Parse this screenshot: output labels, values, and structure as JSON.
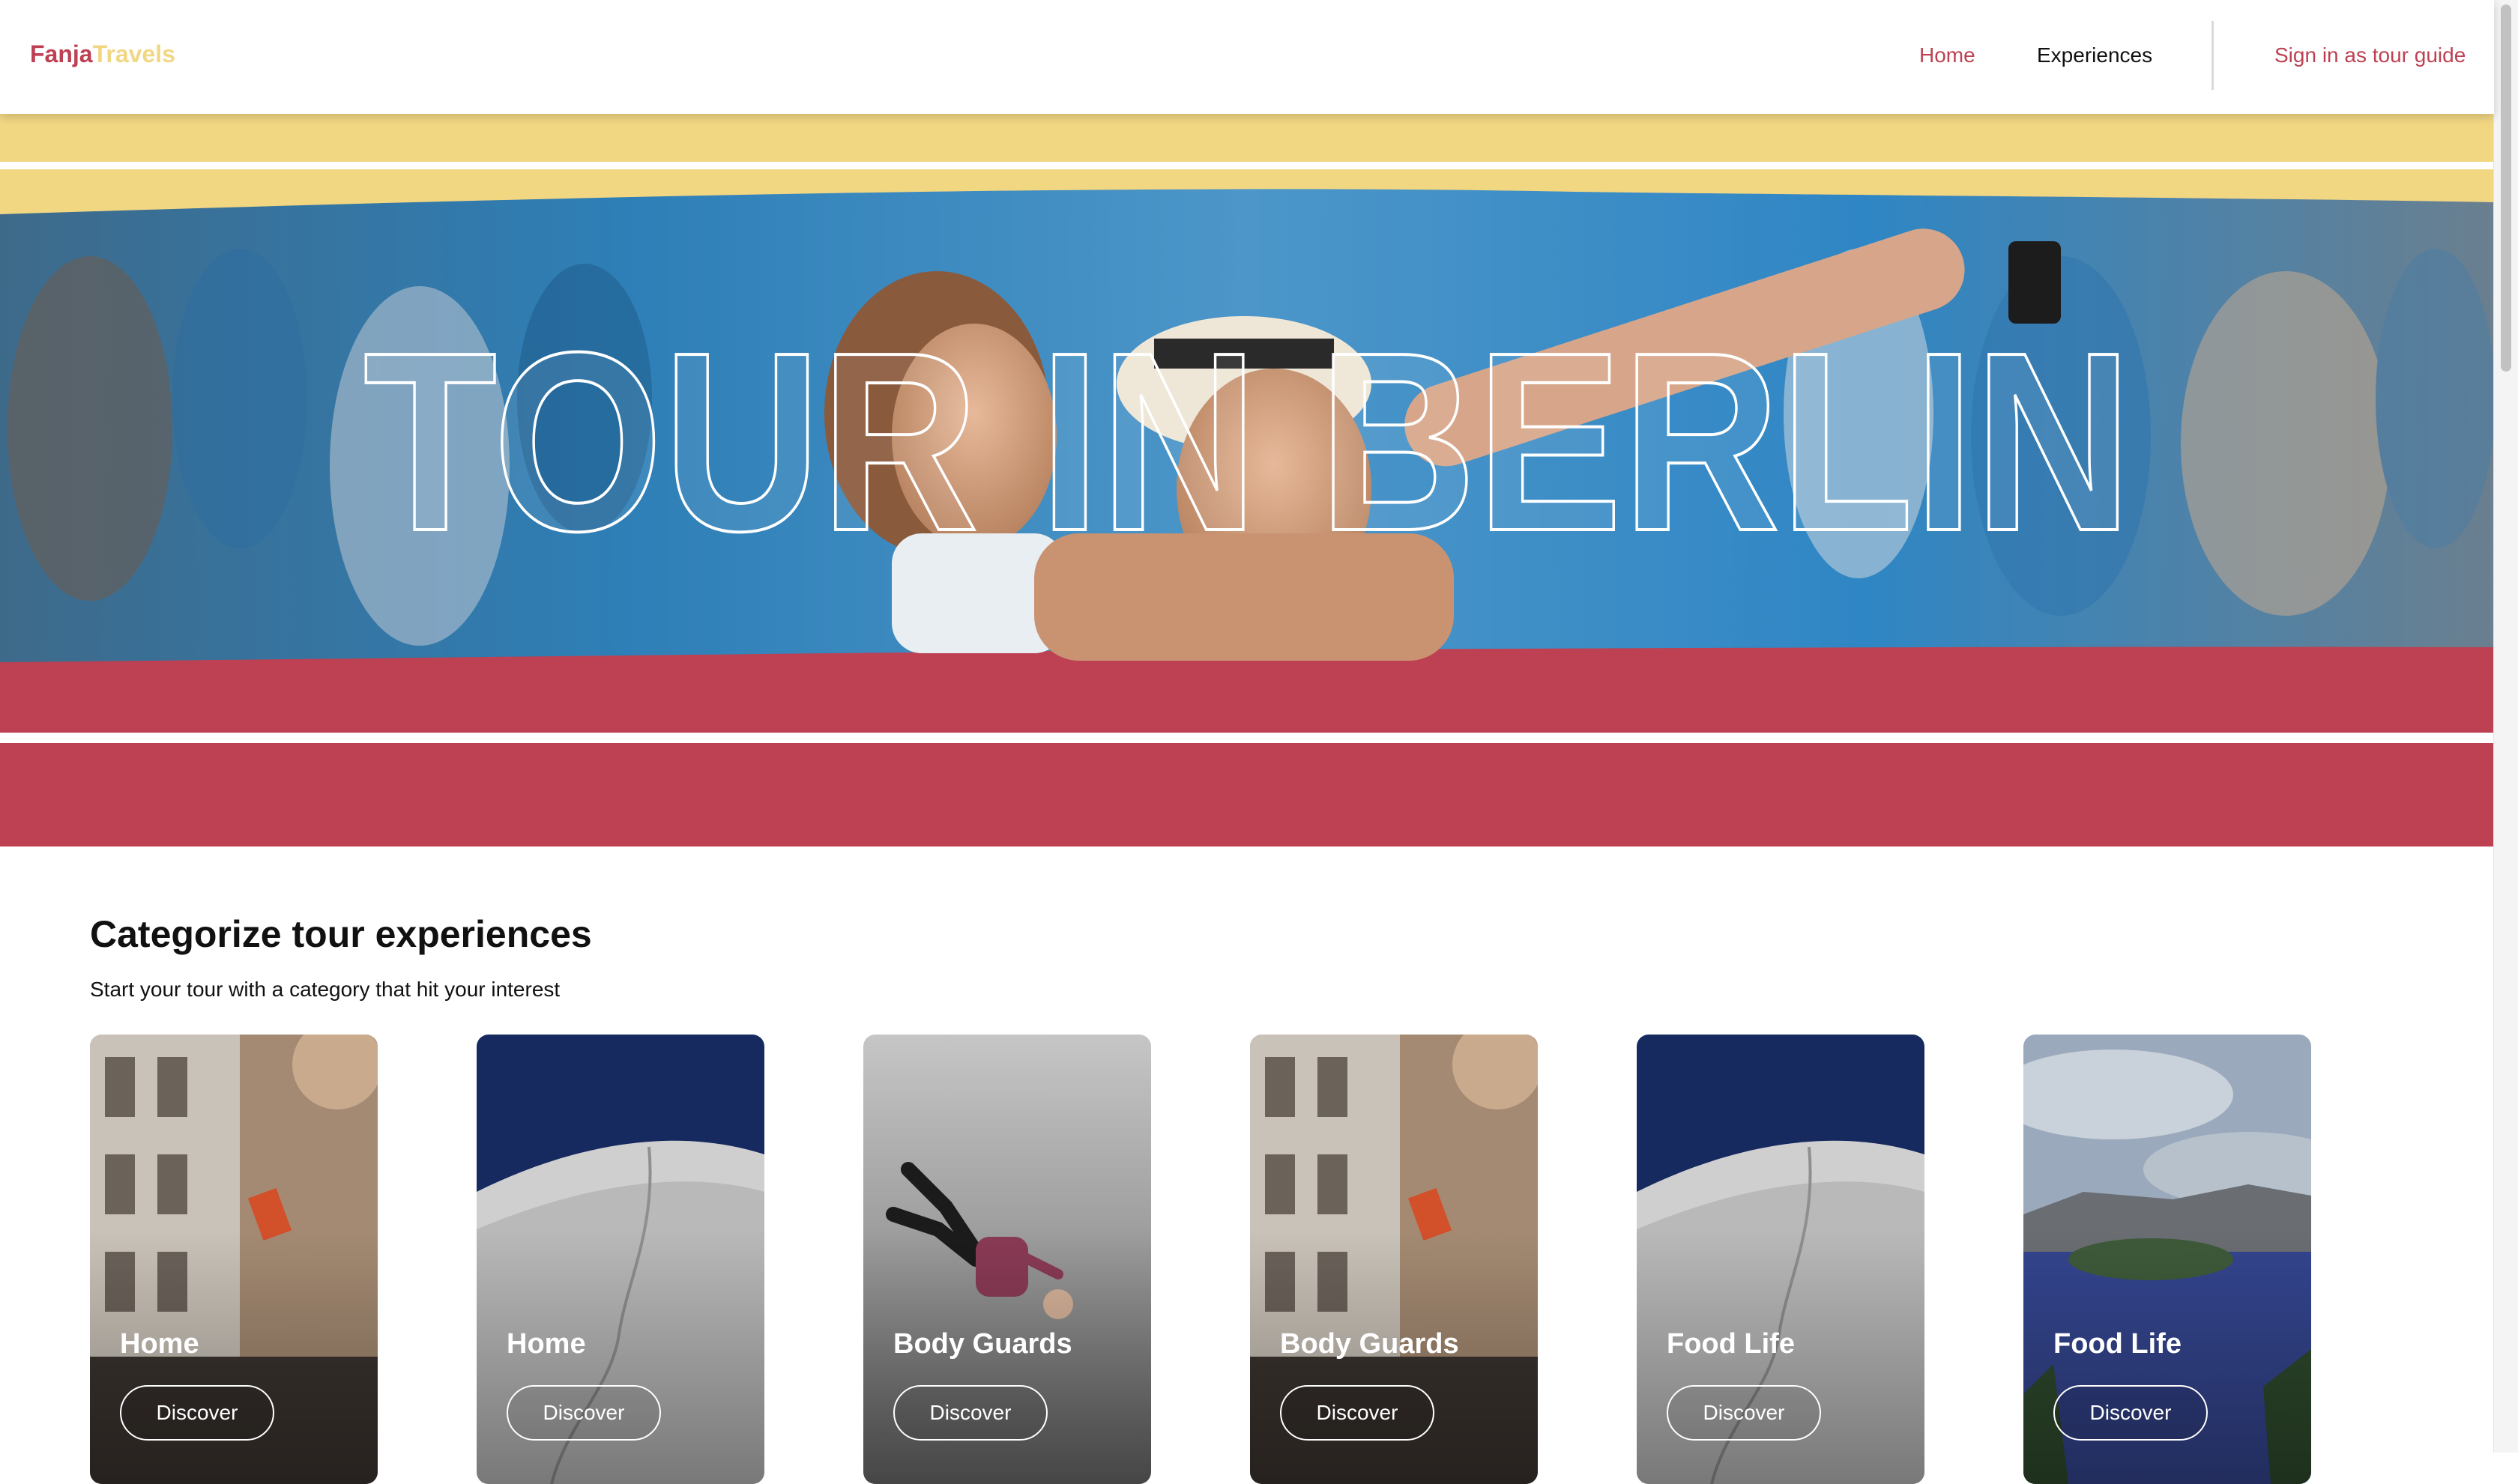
{
  "header": {
    "logo_part1": "Fanja",
    "logo_part2": "Travels",
    "nav": {
      "home": "Home",
      "experiences": "Experiences",
      "sign_in": "Sign in as tour guide"
    }
  },
  "hero": {
    "title": "TOUR IN BERLIN"
  },
  "section": {
    "title": "Categorize tour experiences",
    "subtitle": "Start your tour with a category that hit your interest"
  },
  "cards": [
    {
      "title": "Home",
      "button": "Discover",
      "image": "city-street"
    },
    {
      "title": "Home",
      "button": "Discover",
      "image": "snow-dune"
    },
    {
      "title": "Body Guards",
      "button": "Discover",
      "image": "falling-person"
    },
    {
      "title": "Body Guards",
      "button": "Discover",
      "image": "city-street"
    },
    {
      "title": "Food Life",
      "button": "Discover",
      "image": "snow-dune"
    },
    {
      "title": "Food Life",
      "button": "Discover",
      "image": "crater-lake"
    }
  ],
  "colors": {
    "brand_red": "#bd4152",
    "brand_yellow": "#f2d783"
  }
}
